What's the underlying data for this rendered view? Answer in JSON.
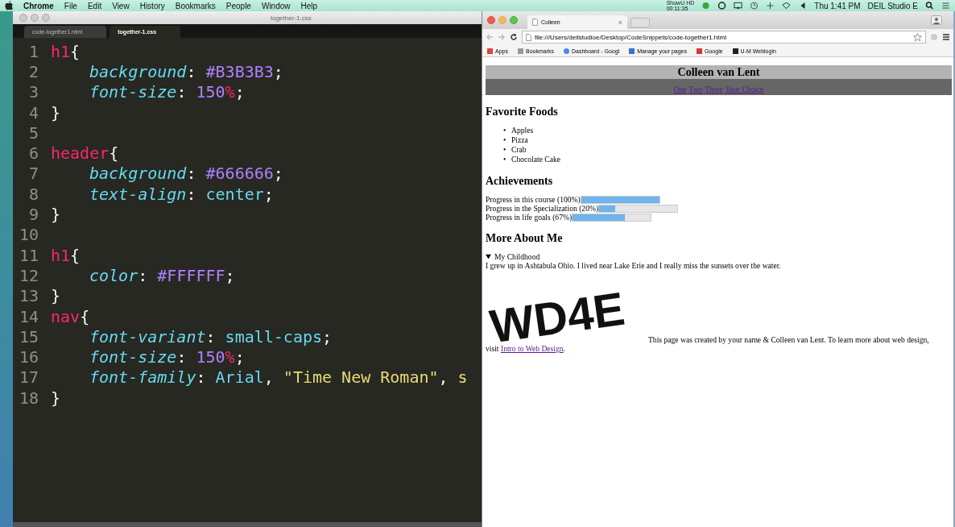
{
  "menu_bar": {
    "app": "Chrome",
    "items": [
      "File",
      "Edit",
      "View",
      "History",
      "Bookmarks",
      "People",
      "Window",
      "Help"
    ],
    "recorder": [
      "ShowU HD",
      "00:11:35"
    ],
    "clock": "Thu 1:41 PM",
    "user": "DEIL Studio E"
  },
  "editor": {
    "title": "together-1.css",
    "tabs": [
      {
        "label": "code-together1.html",
        "selected": false
      },
      {
        "label": "together-1.css",
        "selected": true
      }
    ],
    "lines": [
      {
        "number": "1",
        "indented": false,
        "tokens": [
          {
            "text": "h1",
            "kind": "selector"
          },
          {
            "text": "{",
            "kind": "punct"
          }
        ]
      },
      {
        "number": "2",
        "indented": true,
        "tokens": [
          {
            "text": "background",
            "kind": "property"
          },
          {
            "text": ": ",
            "kind": "punct"
          },
          {
            "text": "#B3B3B3",
            "kind": "number"
          },
          {
            "text": ";",
            "kind": "punct"
          }
        ]
      },
      {
        "number": "3",
        "indented": true,
        "tokens": [
          {
            "text": "font-size",
            "kind": "property"
          },
          {
            "text": ": ",
            "kind": "punct"
          },
          {
            "text": "150",
            "kind": "number"
          },
          {
            "text": "%",
            "kind": "selector"
          },
          {
            "text": ";",
            "kind": "punct"
          }
        ]
      },
      {
        "number": "4",
        "indented": false,
        "tokens": [
          {
            "text": "}",
            "kind": "punct"
          }
        ]
      },
      {
        "number": "5"
      },
      {
        "number": "6",
        "indented": false,
        "tokens": [
          {
            "text": "header",
            "kind": "selector"
          },
          {
            "text": "{",
            "kind": "punct"
          }
        ]
      },
      {
        "number": "7",
        "indented": true,
        "tokens": [
          {
            "text": "background",
            "kind": "property"
          },
          {
            "text": ": ",
            "kind": "punct"
          },
          {
            "text": "#666666",
            "kind": "number"
          },
          {
            "text": ";",
            "kind": "punct"
          }
        ]
      },
      {
        "number": "8",
        "indented": true,
        "tokens": [
          {
            "text": "text-align",
            "kind": "property"
          },
          {
            "text": ": ",
            "kind": "punct"
          },
          {
            "text": "center",
            "kind": "keyword"
          },
          {
            "text": ";",
            "kind": "punct"
          }
        ]
      },
      {
        "number": "9",
        "indented": false,
        "tokens": [
          {
            "text": "}",
            "kind": "punct"
          }
        ]
      },
      {
        "number": "10"
      },
      {
        "number": "11",
        "indented": false,
        "tokens": [
          {
            "text": "h1",
            "kind": "selector"
          },
          {
            "text": "{",
            "kind": "punct"
          }
        ]
      },
      {
        "number": "12",
        "indented": true,
        "tokens": [
          {
            "text": "color",
            "kind": "property"
          },
          {
            "text": ": ",
            "kind": "punct"
          },
          {
            "text": "#FFFFFF",
            "kind": "number"
          },
          {
            "text": ";",
            "kind": "punct"
          }
        ]
      },
      {
        "number": "13",
        "indented": false,
        "tokens": [
          {
            "text": "}",
            "kind": "punct"
          }
        ]
      },
      {
        "number": "14",
        "indented": false,
        "tokens": [
          {
            "text": "nav",
            "kind": "selector"
          },
          {
            "text": "{",
            "kind": "punct"
          }
        ]
      },
      {
        "number": "15",
        "indented": true,
        "tokens": [
          {
            "text": "font-variant",
            "kind": "property"
          },
          {
            "text": ": ",
            "kind": "punct"
          },
          {
            "text": "small-caps",
            "kind": "keyword"
          },
          {
            "text": ";",
            "kind": "punct"
          }
        ]
      },
      {
        "number": "16",
        "indented": true,
        "tokens": [
          {
            "text": "font-size",
            "kind": "property"
          },
          {
            "text": ": ",
            "kind": "punct"
          },
          {
            "text": "150",
            "kind": "number"
          },
          {
            "text": "%",
            "kind": "selector"
          },
          {
            "text": ";",
            "kind": "punct"
          }
        ]
      },
      {
        "number": "17",
        "indented": true,
        "tokens": [
          {
            "text": "font-family",
            "kind": "property"
          },
          {
            "text": ": ",
            "kind": "punct"
          },
          {
            "text": "Arial",
            "kind": "keyword"
          },
          {
            "text": ", ",
            "kind": "punct"
          },
          {
            "text": "\"Time New Roman\"",
            "kind": "string"
          },
          {
            "text": ", ",
            "kind": "punct"
          },
          {
            "text": "s",
            "kind": "string"
          }
        ]
      },
      {
        "number": "18",
        "indented": false,
        "tokens": [
          {
            "text": "}",
            "kind": "punct"
          }
        ]
      }
    ]
  },
  "browser": {
    "tab": "Colleen",
    "tab_close": "×",
    "url": "file:///Users/deilstudioe/Desktop/CodeSnippets/code-together1.html",
    "bookmarks": [
      "Apps",
      "Bookmarks",
      "Dashboard - Googl",
      "Manage your pages",
      "Google",
      "U-M Weblogin"
    ],
    "page": {
      "h1": "Colleen van Lent",
      "nav": [
        "One",
        "Two",
        "Three",
        "Your Choice"
      ],
      "foods_heading": "Favorite Foods",
      "foods": [
        {
          "bullet": "•",
          "text": "Apples"
        },
        {
          "bullet": "•",
          "text": "Pizza"
        },
        {
          "bullet": "•",
          "text": "Crab"
        },
        {
          "bullet": "•",
          "text": "Chocolate Cake"
        }
      ],
      "achievements_heading": "Achievements",
      "progress": [
        {
          "label": "Progress in this course (100%)",
          "level": 1
        },
        {
          "label": "Progress in the Specialization (20%)",
          "level": 0.2
        },
        {
          "label": "Progress in life goals (67%)",
          "level": 0.67
        }
      ],
      "more_heading": "More About Me",
      "details": {
        "summary": "My Childhood",
        "expanded": true,
        "text": "I grew up in Ashtabula Ohio. I lived near Lake Erie and I really miss the sunsets over the water."
      },
      "logo": "WD4E",
      "footer_text": "This page was created by your name & Colleen van Lent. To learn more about web design, visit",
      "footer_link": "Intro to Web Design",
      "footer_end": "."
    }
  }
}
